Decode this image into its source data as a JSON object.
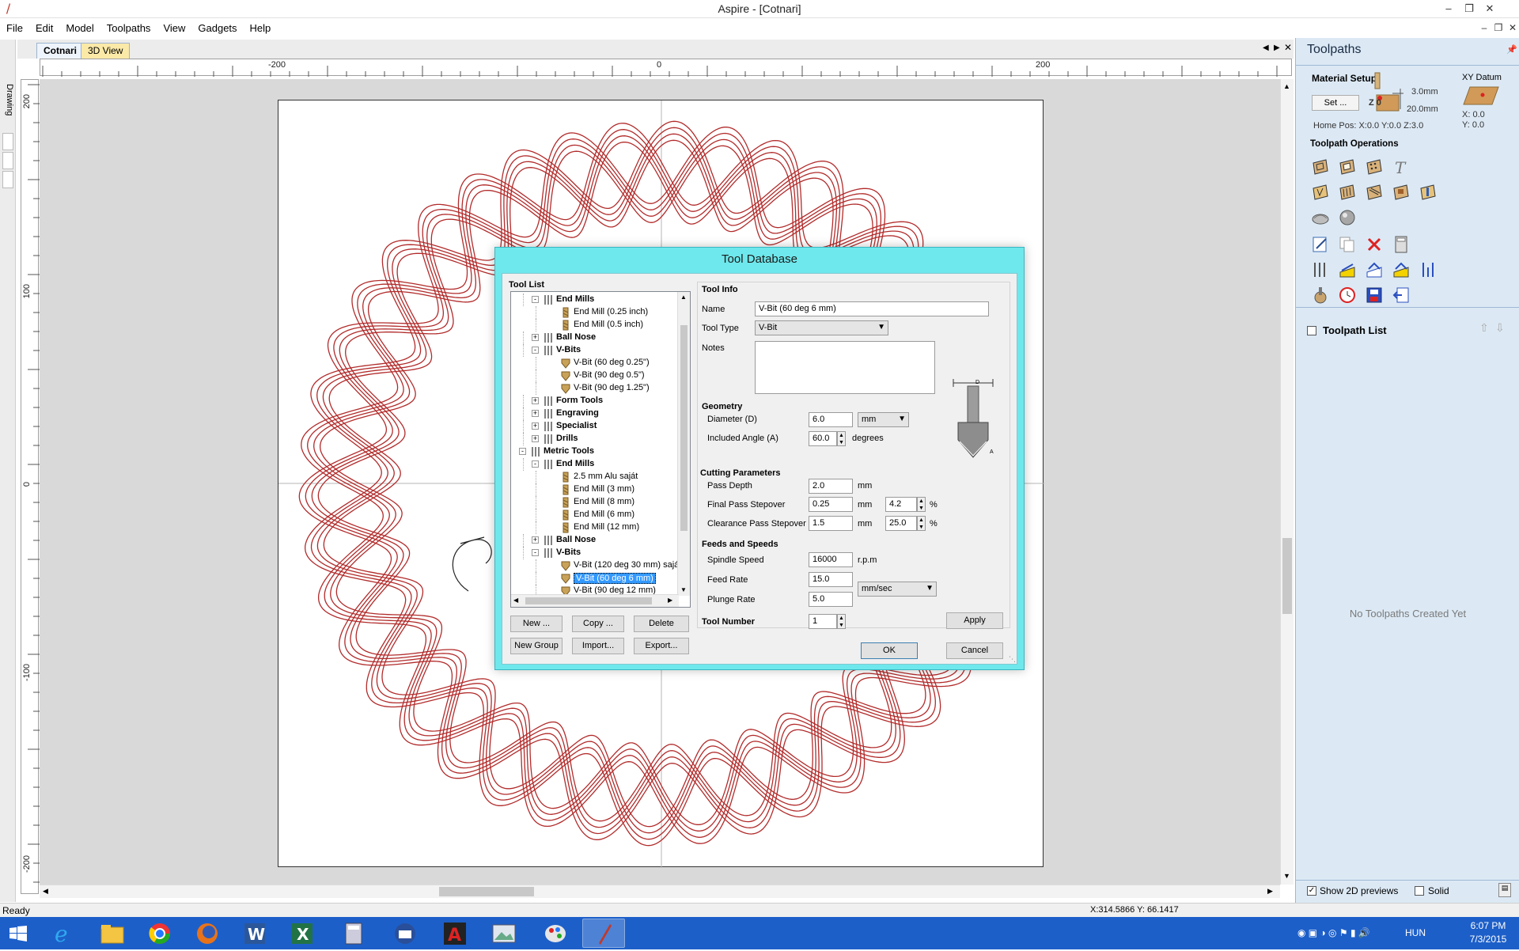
{
  "window": {
    "title": "Aspire - [Cotnari]"
  },
  "menu": [
    "File",
    "Edit",
    "Model",
    "Toolpaths",
    "View",
    "Gadgets",
    "Help"
  ],
  "left_tab": {
    "label": "Drawing"
  },
  "doc_tabs": [
    "Cotnari",
    "3D View"
  ],
  "ruler": {
    "h": [
      "-200",
      "0",
      "200"
    ],
    "v": [
      "200",
      "100",
      "0",
      "-100",
      "-200"
    ]
  },
  "dialog": {
    "title": "Tool Database",
    "tool_list_label": "Tool List",
    "tree": [
      {
        "label": "End Mills",
        "level": 1,
        "type": "group",
        "expander": "-"
      },
      {
        "label": "End Mill (0.25 inch)",
        "level": 2,
        "type": "endmill"
      },
      {
        "label": "End Mill (0.5 inch)",
        "level": 2,
        "type": "endmill"
      },
      {
        "label": "Ball Nose",
        "level": 1,
        "type": "group",
        "expander": "+"
      },
      {
        "label": "V-Bits",
        "level": 1,
        "type": "group",
        "expander": "-"
      },
      {
        "label": "V-Bit (60 deg 0.25\")",
        "level": 2,
        "type": "vbit"
      },
      {
        "label": "V-Bit (90 deg 0.5\")",
        "level": 2,
        "type": "vbit"
      },
      {
        "label": "V-Bit (90 deg 1.25\")",
        "level": 2,
        "type": "vbit"
      },
      {
        "label": "Form Tools",
        "level": 1,
        "type": "group",
        "expander": "+"
      },
      {
        "label": "Engraving",
        "level": 1,
        "type": "group",
        "expander": "+"
      },
      {
        "label": "Specialist",
        "level": 1,
        "type": "group",
        "expander": "+"
      },
      {
        "label": "Drills",
        "level": 1,
        "type": "group",
        "expander": "+"
      },
      {
        "label": "Metric Tools",
        "level": 0,
        "type": "group",
        "expander": "-"
      },
      {
        "label": "End Mills",
        "level": 1,
        "type": "group",
        "expander": "-"
      },
      {
        "label": "2.5 mm Alu saját",
        "level": 2,
        "type": "endmill"
      },
      {
        "label": "End Mill (3 mm)",
        "level": 2,
        "type": "endmill"
      },
      {
        "label": "End Mill (8 mm)",
        "level": 2,
        "type": "endmill"
      },
      {
        "label": "End Mill (6 mm)",
        "level": 2,
        "type": "endmill"
      },
      {
        "label": "End Mill (12 mm)",
        "level": 2,
        "type": "endmill"
      },
      {
        "label": "Ball Nose",
        "level": 1,
        "type": "group",
        "expander": "+"
      },
      {
        "label": "V-Bits",
        "level": 1,
        "type": "group",
        "expander": "-"
      },
      {
        "label": "V-Bit (120 deg 30 mm) sajá",
        "level": 2,
        "type": "vbit"
      },
      {
        "label": "V-Bit (60 deg 6 mm)",
        "level": 2,
        "type": "vbit",
        "selected": true
      },
      {
        "label": "V-Bit (90 deg 12 mm)",
        "level": 2,
        "type": "vbit"
      }
    ],
    "list_buttons": {
      "new": "New ...",
      "copy": "Copy ...",
      "delete": "Delete",
      "new_group": "New Group",
      "import": "Import...",
      "export": "Export..."
    },
    "tool_info": {
      "header": "Tool Info",
      "name_label": "Name",
      "name_value": "V-Bit (60 deg 6 mm)",
      "type_label": "Tool Type",
      "type_value": "V-Bit",
      "notes_label": "Notes"
    },
    "geometry": {
      "header": "Geometry",
      "diameter_label": "Diameter (D)",
      "diameter_value": "6.0",
      "unit_value": "mm",
      "angle_label": "Included Angle (A)",
      "angle_value": "60.0",
      "angle_unit": "degrees"
    },
    "cutting": {
      "header": "Cutting Parameters",
      "pass_depth_label": "Pass Depth",
      "pass_depth_value": "2.0",
      "pass_depth_unit": "mm",
      "final_label": "Final Pass Stepover",
      "final_value": "0.25",
      "final_unit": "mm",
      "final_pct": "4.2",
      "pct_sign": "%",
      "clear_label": "Clearance Pass Stepover",
      "clear_value": "1.5",
      "clear_unit": "mm",
      "clear_pct": "25.0"
    },
    "feeds": {
      "header": "Feeds and Speeds",
      "spindle_label": "Spindle Speed",
      "spindle_value": "16000",
      "spindle_unit": "r.p.m",
      "feed_label": "Feed Rate",
      "feed_value": "15.0",
      "rate_unit": "mm/sec",
      "plunge_label": "Plunge Rate",
      "plunge_value": "5.0"
    },
    "tool_number": {
      "label": "Tool Number",
      "value": "1"
    },
    "diagram_labels": {
      "d": "D",
      "a": "A"
    },
    "apply": "Apply",
    "ok": "OK",
    "cancel": "Cancel"
  },
  "toolpaths_panel": {
    "title": "Toolpaths",
    "material_setup": "Material Setup",
    "set_button": "Set ...",
    "z0": "Z 0",
    "thickness_top": "3.0mm",
    "thickness_bottom": "20.0mm",
    "home_pos": "Home Pos:  X:0.0 Y:0.0 Z:3.0",
    "xy_datum": "XY Datum",
    "datum_x": "X: 0.0",
    "datum_y": "Y: 0.0",
    "operations": "Toolpath Operations",
    "toolpath_list": "Toolpath List",
    "no_toolpaths": "No Toolpaths Created Yet",
    "show_2d": "Show 2D previews",
    "solid": "Solid"
  },
  "status": {
    "text": "Ready",
    "coords": "X:314.5866 Y: 66.1417"
  },
  "taskbar": {
    "language": "HUN",
    "time": "6:07 PM",
    "date": "7/3/2015"
  },
  "colors": {
    "accent": "#6ee8ec",
    "knot": "#b22b2b",
    "taskbar": "#1d5fc9",
    "panel": "#dce9f5"
  }
}
